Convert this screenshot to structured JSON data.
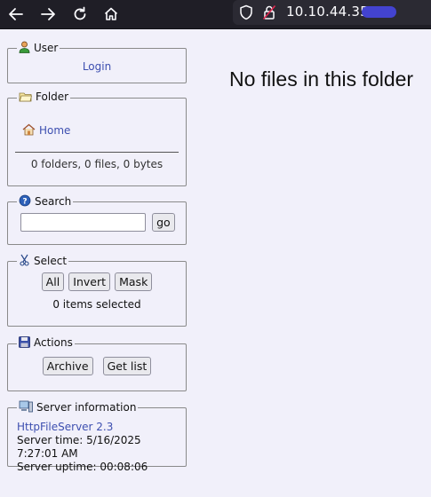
{
  "browser": {
    "url": "10.10.44.35:",
    "icons": [
      "back-arrow-icon",
      "forward-arrow-icon",
      "reload-icon",
      "home-icon",
      "shield-icon",
      "lock-insecure-icon"
    ]
  },
  "user_panel": {
    "title": "User",
    "login_link": "Login"
  },
  "folder_panel": {
    "title": "Folder",
    "home_link": "Home",
    "stats": "0 folders, 0 files, 0 bytes"
  },
  "search_panel": {
    "title": "Search",
    "input_value": "",
    "go_label": "go"
  },
  "select_panel": {
    "title": "Select",
    "buttons": [
      "All",
      "Invert",
      "Mask"
    ],
    "status": "0 items selected"
  },
  "actions_panel": {
    "title": "Actions",
    "archive_label": "Archive",
    "getlist_label": "Get list"
  },
  "server_panel": {
    "title": "Server information",
    "server_link": "HttpFileServer 2.3",
    "server_time": "Server time: 5/16/2025 7:27:01 AM",
    "server_uptime": "Server uptime: 00:08:06"
  },
  "main": {
    "message": "No files in this folder"
  },
  "colors": {
    "page_bg": "#f1f0fa",
    "link": "#3d4fb0",
    "chrome_bg": "#1f1e26",
    "redaction": "#4343d0"
  }
}
